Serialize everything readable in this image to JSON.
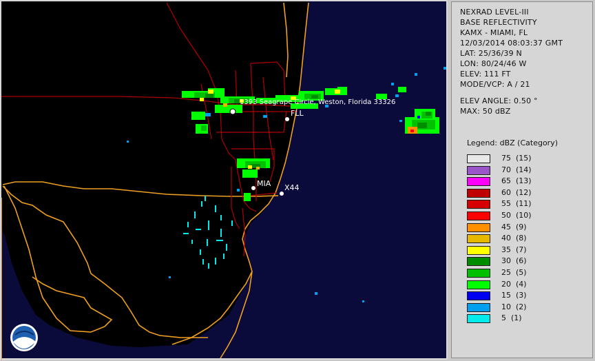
{
  "info": {
    "lines1": [
      "NEXRAD LEVEL-III",
      "BASE REFLECTIVITY",
      "KAMX - MIAMI, FL",
      "12/03/2014 08:03:37 GMT",
      "LAT: 25/36/39 N",
      "LON: 80/24/46 W",
      "ELEV: 111 FT",
      "MODE/VCP: A / 21"
    ],
    "lines2": [
      "ELEV ANGLE: 0.50 °",
      "MAX: 50 dBZ"
    ]
  },
  "legend": {
    "title": "Legend: dBZ (Category)",
    "items": [
      {
        "label": "75  (15)",
        "color": "#e8e8e8"
      },
      {
        "label": "70  (14)",
        "color": "#9955c9"
      },
      {
        "label": "65  (13)",
        "color": "#ff00ff"
      },
      {
        "label": "60  (12)",
        "color": "#c00000"
      },
      {
        "label": "55  (11)",
        "color": "#d60000"
      },
      {
        "label": "50  (10)",
        "color": "#ff0000"
      },
      {
        "label": "45  (9)",
        "color": "#ff9000"
      },
      {
        "label": "40  (8)",
        "color": "#e6b800"
      },
      {
        "label": "35  (7)",
        "color": "#ffff00"
      },
      {
        "label": "30  (6)",
        "color": "#008c00"
      },
      {
        "label": "25  (5)",
        "color": "#00c000"
      },
      {
        "label": "20  (4)",
        "color": "#00ff00"
      },
      {
        "label": "15  (3)",
        "color": "#0000f0"
      },
      {
        "label": "10  (2)",
        "color": "#00a0f0"
      },
      {
        "label": "5  (1)",
        "color": "#00ecec"
      }
    ]
  },
  "map": {
    "marker_address": "1393 Seagrape Circle, Weston, Florida 33326",
    "marker_fll": "FLL",
    "marker_mia": "MIA",
    "marker_x44": "X44",
    "logo_text": "NOAA",
    "colors": {
      "ocean": "#0b0b3b",
      "land": "#000000",
      "county": "#f0a020",
      "roads": "#b00000"
    }
  }
}
